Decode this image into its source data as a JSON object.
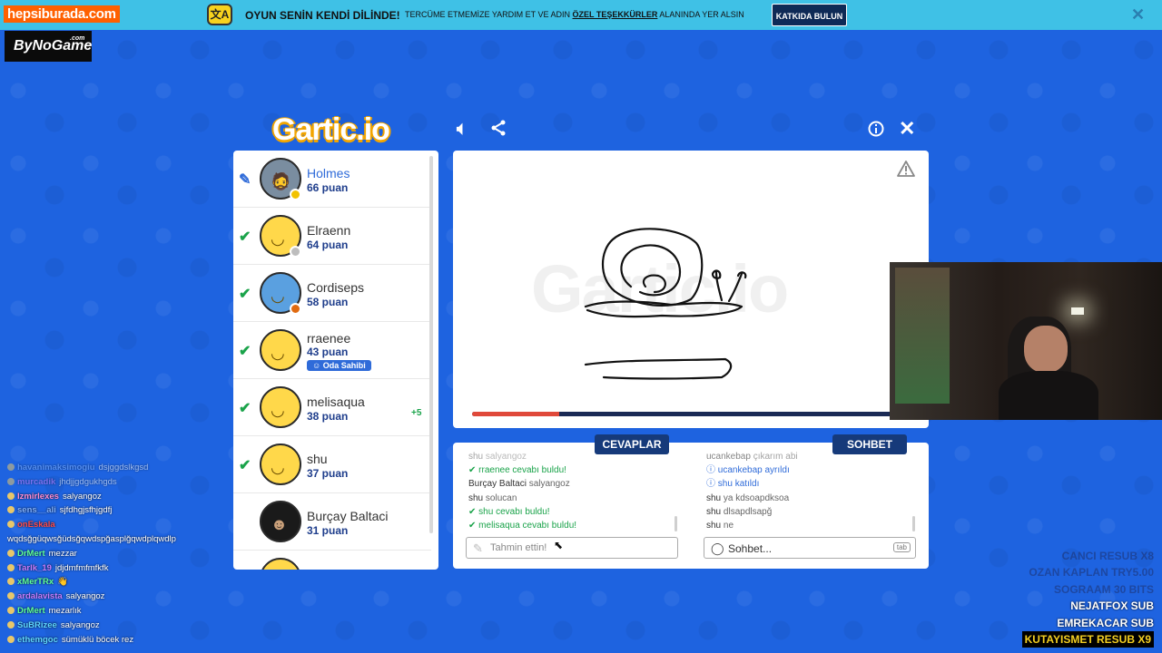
{
  "banner": {
    "store_logo": "hepsiburada.com",
    "title": "OYUN SENİN KENDİ DİLİNDE!",
    "text_before": "TERCÜME ETMEMİZE YARDIM ET VE ADIN",
    "text_link": "ÖZEL TEŞEKKÜRLER",
    "text_after": "ALANINDA YER ALSIN",
    "button": "KATKIDA BULUN",
    "close": "✕"
  },
  "sponsor": {
    "name": "ByNoGame",
    "suffix": ".com"
  },
  "game": {
    "logo": "Gartic.io",
    "watermark": "Gartic.io"
  },
  "players": [
    {
      "name": "Holmes",
      "score": "66 puan",
      "status": "drawing",
      "avatar": "photo",
      "dot": "#f2c200"
    },
    {
      "name": "Elraenn",
      "score": "64 puan",
      "status": "guessed",
      "avatar": "smile",
      "dot": "#bdbdbd"
    },
    {
      "name": "Cordiseps",
      "score": "58 puan",
      "status": "guessed",
      "avatar": "hat",
      "dot": "#e06a10"
    },
    {
      "name": "rraenee",
      "score": "43 puan",
      "status": "guessed",
      "avatar": "smile",
      "badge": "Oda Sahibi"
    },
    {
      "name": "melisaqua",
      "score": "38 puan",
      "status": "guessed",
      "avatar": "smile",
      "bonus": "+5"
    },
    {
      "name": "shu",
      "score": "37 puan",
      "status": "guessed",
      "avatar": "smile"
    },
    {
      "name": "Burçay Baltaci",
      "score": "31 puan",
      "status": "none",
      "avatar": "dark"
    }
  ],
  "round": {
    "time_remaining_fraction": 0.2
  },
  "answers": {
    "tab": "CEVAPLAR",
    "messages": [
      {
        "type": "plain",
        "user": "shu",
        "text": "salyangoz"
      },
      {
        "type": "ok",
        "user": "rraenee",
        "text": "cevabı buldu!"
      },
      {
        "type": "plain",
        "user": "Burçay Baltaci",
        "text": "salyangoz"
      },
      {
        "type": "plain",
        "user": "shu",
        "text": "solucan"
      },
      {
        "type": "ok",
        "user": "shu",
        "text": "cevabı buldu!"
      },
      {
        "type": "ok",
        "user": "melisaqua",
        "text": "cevabı buldu!"
      }
    ],
    "placeholder": "Tahmin ettin!"
  },
  "chat": {
    "tab": "SOHBET",
    "messages": [
      {
        "type": "plain",
        "user": "ucankebap",
        "text": "çıkarım abi"
      },
      {
        "type": "info",
        "user": "ucankebap",
        "text": "ayrıldı"
      },
      {
        "type": "info",
        "user": "shu",
        "text": "katıldı"
      },
      {
        "type": "plain",
        "user": "shu",
        "text": "ya kdsoapdksoa"
      },
      {
        "type": "plain",
        "user": "shu",
        "text": "dlsapdlsapğ"
      },
      {
        "type": "plain",
        "user": "shu",
        "text": "ne"
      }
    ],
    "placeholder": "Sohbet...",
    "key_hint": "tab"
  },
  "stream_chat": [
    {
      "user": "havanimaksimogiu",
      "color": "#7fb0ff",
      "text": "dsjggdslkgsd"
    },
    {
      "user": "murcadik",
      "color": "#c77dff",
      "text": "jhdjjgdgukhgds"
    },
    {
      "user": "Izmirlexes",
      "color": "#ff8ccf",
      "text": "salyangoz"
    },
    {
      "user": "sens__ali",
      "color": "#7fb0ff",
      "text": "sjfdhgjsfhjgdfj"
    },
    {
      "user": "onEskala",
      "color": "#ff4b4b",
      "text": ""
    },
    {
      "user": "",
      "color": "#ffffff",
      "text": "wqdsğgüqwsğüdsğqwdspğasplğqwdplqwdlp"
    },
    {
      "user": "DrMert",
      "color": "#5fff9a",
      "text": "mezzar"
    },
    {
      "user": "Tarlk_19",
      "color": "#c77dff",
      "text": "jdjdmfmfmfkfk"
    },
    {
      "user": "xMerTRx",
      "color": "#5fff9a",
      "text": "👋"
    },
    {
      "user": "ardalavista",
      "color": "#c77dff",
      "text": "salyangoz"
    },
    {
      "user": "DrMert",
      "color": "#5fff9a",
      "text": "mezarlık"
    },
    {
      "user": "SuBRizee",
      "color": "#5fd7ff",
      "text": "salyangoz"
    },
    {
      "user": "ethemgoc",
      "color": "#5fd7ff",
      "text": "sümüklü böcek rez"
    }
  ],
  "sub_feed": [
    {
      "text": "CANCI  RESUB X8",
      "style": "faded"
    },
    {
      "text": "OZAN KAPLAN  TRY5.00",
      "style": "faded"
    },
    {
      "text": "SOGRAAM  30 BITS",
      "style": "faded"
    },
    {
      "text": "NEJATFOX  SUB",
      "style": "normal"
    },
    {
      "text": "EMREKACAR  SUB",
      "style": "normal"
    },
    {
      "text": "KUTAYISMET  RESUB X9",
      "style": "highlight"
    }
  ],
  "colors": {
    "background": "#1e63e0",
    "accent": "#2f6bd9",
    "success": "#1aa34a",
    "tab": "#163a7a",
    "timer": "#e0493a"
  }
}
